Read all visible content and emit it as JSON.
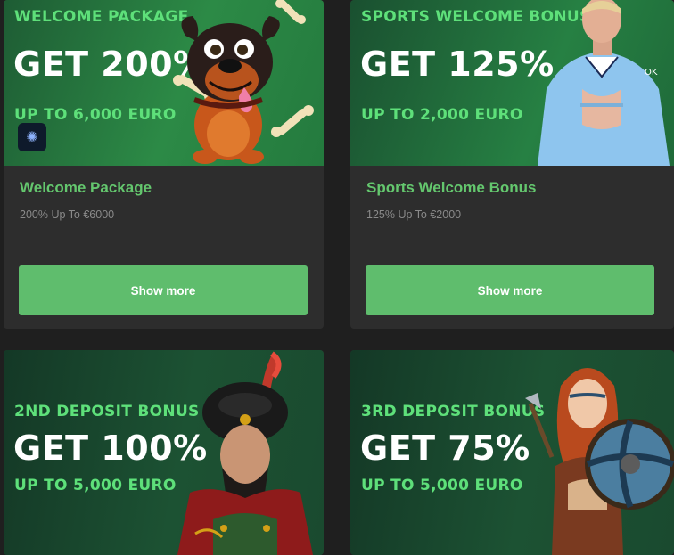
{
  "promotions": [
    {
      "banner_small": "WELCOME PACKAGE",
      "banner_big": "GET 200%",
      "banner_sub": "UP TO 6,000 EURO",
      "title": "Welcome Package",
      "description": "200% Up To €6000",
      "button_label": "Show more"
    },
    {
      "banner_small": "SPORTS WELCOME BONUS",
      "banner_big": "GET 125%",
      "banner_sub": "UP TO 2,000 EURO",
      "title": "Sports Welcome Bonus",
      "description": "125% Up To €2000",
      "button_label": "Show more"
    },
    {
      "banner_small": "2ND DEPOSIT BONUS",
      "banner_big": "GET 100%",
      "banner_sub": "UP TO 5,000 EURO"
    },
    {
      "banner_small": "3RD DEPOSIT BONUS",
      "banner_big": "GET 75%",
      "banner_sub": "UP TO 5,000 EURO"
    }
  ],
  "icons": {
    "chip": "brain-icon"
  },
  "colors": {
    "page_background": "#1f1f1f",
    "card_background": "#2d2d2d",
    "accent_green": "#5fbd6d",
    "banner_text_green": "#5ee07a",
    "title_green": "#64c76e",
    "description_gray": "#8a8a8a"
  }
}
